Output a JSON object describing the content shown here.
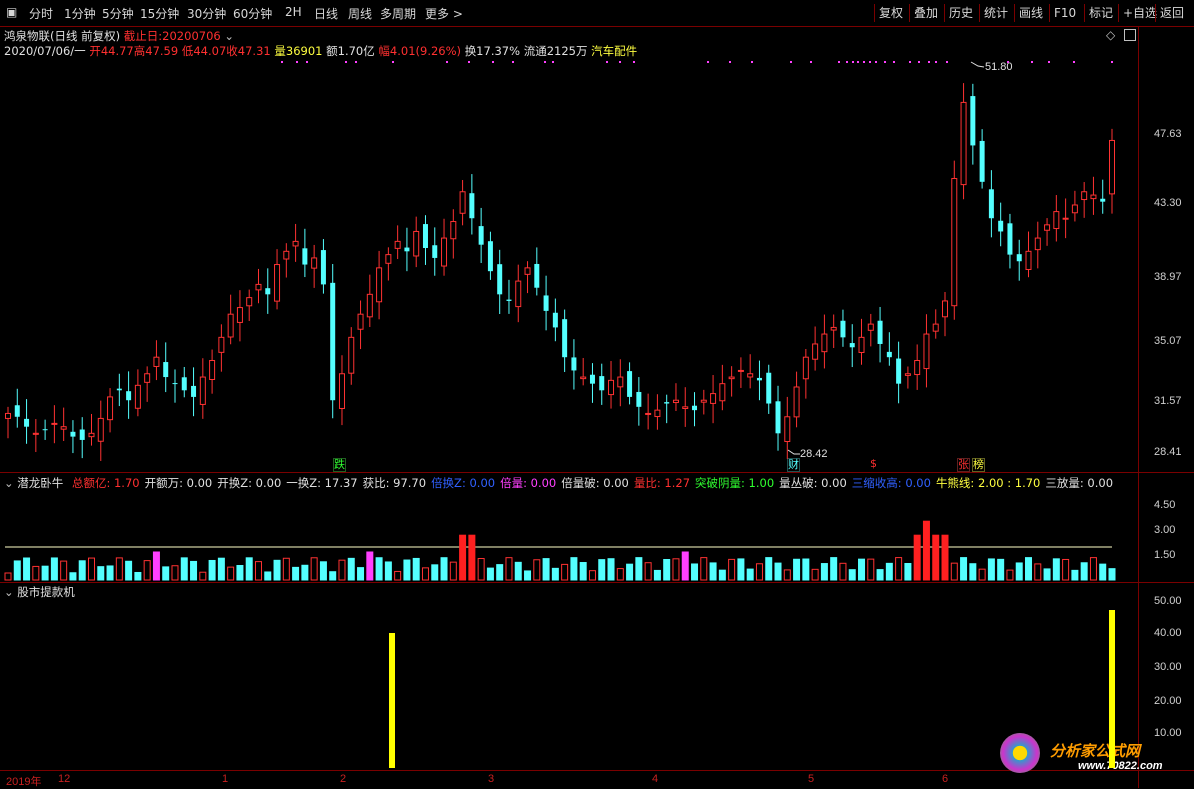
{
  "toolbar": {
    "left": [
      "分时",
      "1分钟",
      "5分钟",
      "15分钟",
      "30分钟",
      "60分钟",
      "2H",
      "日线",
      "周线",
      "多周期",
      "更多 >"
    ],
    "right": [
      "复权",
      "叠加",
      "历史",
      "统计",
      "画线",
      "F10",
      "标记",
      "+自选",
      "返回"
    ]
  },
  "header": {
    "stock_name": "鸿泉物联",
    "mode": "(日线 前复权)",
    "cutoff_label": "截止日:20200706",
    "date": "2020/07/06/一",
    "open": "开44.77",
    "high": "高47.59",
    "low": "低44.07",
    "close": "收47.31",
    "volume": "量36901",
    "amount": "额1.70亿",
    "change": "幅4.01(9.26%)",
    "turnover": "换17.37%",
    "float": "流通2125万",
    "sector": "汽车配件"
  },
  "price_axis": [
    "47.63",
    "43.30",
    "38.97",
    "35.07",
    "31.57",
    "28.41"
  ],
  "annotations": {
    "high_mark": "51.80",
    "low_mark": "28.42",
    "fall": "跌",
    "cai": "财",
    "s": "$",
    "zhang": "张",
    "bang": "榜"
  },
  "indicator1": {
    "title": "潜龙卧牛",
    "fields": [
      {
        "label": "总额亿:",
        "value": "1.70",
        "color": "#ff3030"
      },
      {
        "label": "开额万:",
        "value": "0.00",
        "color": "#e0e0e0"
      },
      {
        "label": "开换Z:",
        "value": "0.00",
        "color": "#e0e0e0"
      },
      {
        "label": "一换Z:",
        "value": "17.37",
        "color": "#e0e0e0"
      },
      {
        "label": "获比:",
        "value": "97.70",
        "color": "#e0e0e0"
      },
      {
        "label": "倍换Z:",
        "value": "0.00",
        "color": "#3060ff"
      },
      {
        "label": "倍量:",
        "value": "0.00",
        "color": "#ff40ff"
      },
      {
        "label": "倍量破:",
        "value": "0.00",
        "color": "#e0e0e0"
      },
      {
        "label": "量比:",
        "value": "1.27",
        "color": "#ff3030"
      },
      {
        "label": "突破阴量:",
        "value": "1.00",
        "color": "#30ff30"
      },
      {
        "label": "量丛破:",
        "value": "0.00",
        "color": "#e0e0e0"
      },
      {
        "label": "三缩收高:",
        "value": "0.00",
        "color": "#3060ff"
      },
      {
        "label": "牛熊线:",
        "value": "2.00 : 1.70",
        "color": "#ffff40"
      },
      {
        "label": "三放量:",
        "value": "0.00",
        "color": "#e0e0e0"
      }
    ],
    "axis": [
      "4.50",
      "3.00",
      "1.50"
    ]
  },
  "indicator2": {
    "title": "股市提款机",
    "axis": [
      "50.00",
      "40.00",
      "30.00",
      "20.00",
      "10.00"
    ]
  },
  "date_axis": [
    "2019年",
    "12",
    "1",
    "2",
    "3",
    "4",
    "5",
    "6"
  ],
  "watermark": {
    "cn": "分析家公式网",
    "url": "www.70822.com"
  },
  "colors": {
    "up": "#ff3232",
    "down": "#54ffff",
    "border": "#7a0000",
    "yellow": "#ffff00",
    "magenta": "#ff40ff"
  }
}
